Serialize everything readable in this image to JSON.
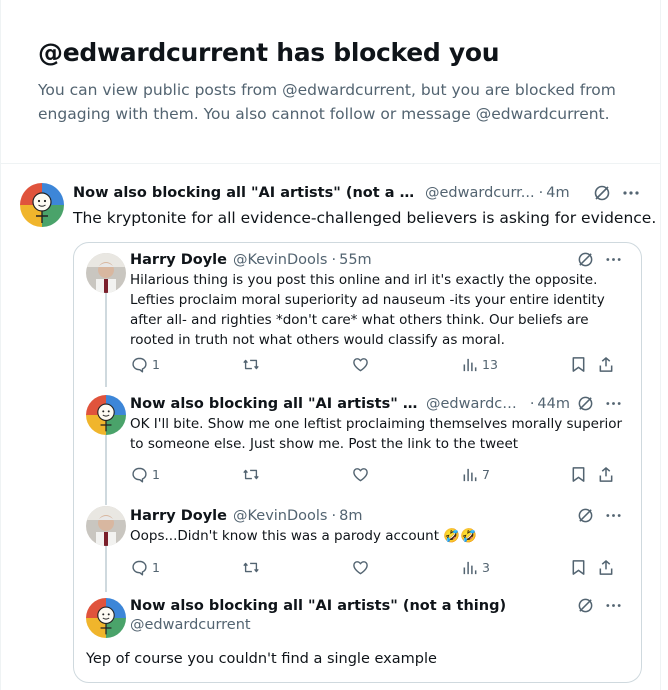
{
  "blocked": {
    "title": "@edwardcurrent has blocked you",
    "message": "You can view public posts from @edwardcurrent, but you are blocked from engaging with them. You also cannot follow or message @edwardcurrent."
  },
  "main_tweet": {
    "name": "Now also blocking all \"AI artists\" (not a thi...",
    "handle": "@edwardcurr...",
    "time": "4m",
    "text": "The kryptonite for all evidence-challenged believers is asking for evidence."
  },
  "quote": {
    "tweets": [
      {
        "name": "Harry Doyle",
        "handle": "@KevinDools",
        "time": "55m",
        "text": "Hilarious thing is you post this online and irl it's exactly the opposite. Lefties proclaim moral superiority ad nauseum -its your entire identity after all- and righties *don't care* what others think. Our beliefs are rooted in truth not what others would classify as moral.",
        "replies": "1",
        "views": "13"
      },
      {
        "name": "Now also blocking all \"AI artists\" (not a th...",
        "handle": "@edwardcurr...",
        "time": "44m",
        "text": "OK I'll bite. Show me one leftist proclaiming themselves morally superior to someone else. Just show me. Post the link to the tweet",
        "replies": "1",
        "views": "7"
      },
      {
        "name": "Harry Doyle",
        "handle": "@KevinDools",
        "time": "8m",
        "text": "Oops...Didn't know this was a parody account 🤣🤣",
        "replies": "1",
        "views": "3"
      },
      {
        "name": "Now also blocking all \"AI artists\" (not a thing)",
        "handle": "@edwardcurrent",
        "text": "Yep of course you couldn't find a single example"
      }
    ]
  },
  "icons": {
    "reply": "reply-icon",
    "retweet": "retweet-icon",
    "like": "like-icon",
    "views": "views-icon",
    "bookmark": "bookmark-icon",
    "share": "share-icon",
    "grok": "grok-icon",
    "more": "more-icon"
  },
  "colors": {
    "text": "#0f1419",
    "secondary": "#536471",
    "border": "#cfd9de"
  }
}
